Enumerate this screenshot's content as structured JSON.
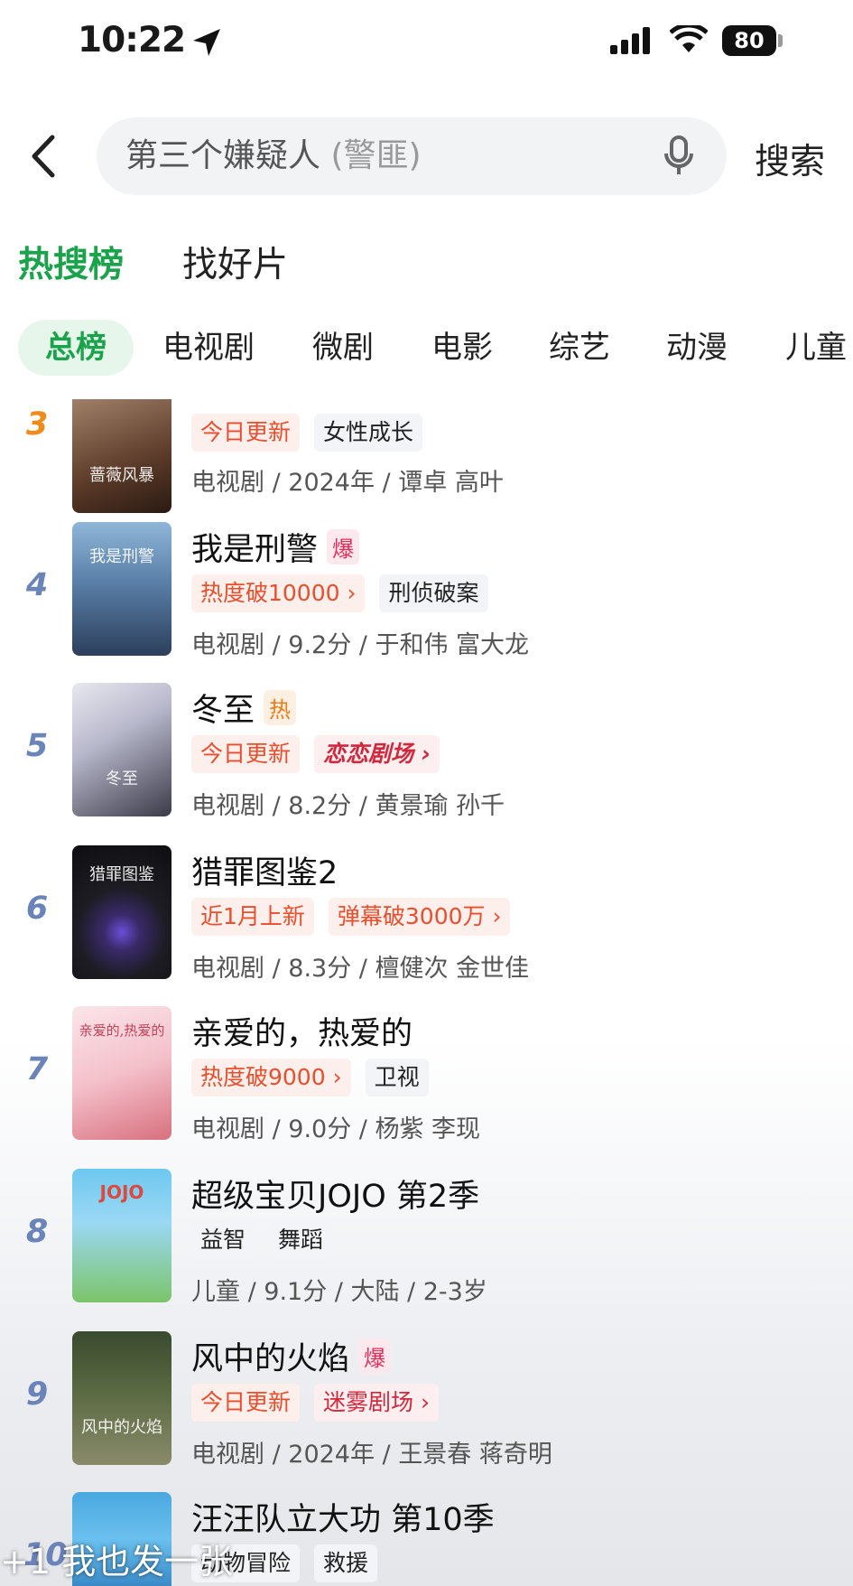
{
  "status": {
    "time": "10:22",
    "battery": "80"
  },
  "search": {
    "query": "第三个嫌疑人",
    "hint": "(警匪)",
    "button": "搜索"
  },
  "tabs": [
    "热搜榜",
    "找好片"
  ],
  "chips": [
    "总榜",
    "电视剧",
    "微剧",
    "电影",
    "综艺",
    "动漫",
    "儿童"
  ],
  "items": [
    {
      "rank": "3",
      "title": "",
      "badge": "",
      "poster_text": "蔷薇风暴",
      "tags": [
        "今日更新",
        "女性成长"
      ],
      "meta": "电视剧 / 2024年 / 谭卓 高叶"
    },
    {
      "rank": "4",
      "title": "我是刑警",
      "badge": "爆",
      "poster_text": "我是刑警",
      "tags": [
        "热度破10000 ›",
        "刑侦破案"
      ],
      "meta": "电视剧 / 9.2分 / 于和伟 富大龙"
    },
    {
      "rank": "5",
      "title": "冬至",
      "badge": "热",
      "poster_text": "冬至",
      "tags": [
        "今日更新",
        "恋恋剧场 ›"
      ],
      "meta": "电视剧 / 8.2分 / 黄景瑜 孙千"
    },
    {
      "rank": "6",
      "title": "猎罪图鉴2",
      "badge": "",
      "poster_text": "猎罪图鉴",
      "tags": [
        "近1月上新",
        "弹幕破3000万 ›"
      ],
      "meta": "电视剧 / 8.3分 / 檀健次 金世佳"
    },
    {
      "rank": "7",
      "title": "亲爱的，热爱的",
      "badge": "",
      "poster_text": "亲爱的,热爱的",
      "tags": [
        "热度破9000 ›",
        "卫视"
      ],
      "meta": "电视剧 / 9.0分 / 杨紫 李现"
    },
    {
      "rank": "8",
      "title": "超级宝贝JOJO 第2季",
      "badge": "",
      "poster_text": "JOJO",
      "tags": [
        "益智",
        "舞蹈"
      ],
      "meta": "儿童 / 9.1分 / 大陆 / 2-3岁"
    },
    {
      "rank": "9",
      "title": "风中的火焰",
      "badge": "爆",
      "poster_text": "风中的火焰",
      "tags": [
        "今日更新",
        "迷雾剧场 ›"
      ],
      "meta": "电视剧 / 2024年 / 王景春 蒋奇明"
    },
    {
      "rank": "10",
      "title": "汪汪队立大功 第10季",
      "badge": "",
      "poster_text": "",
      "tags": [
        "动物冒险",
        "救援"
      ],
      "meta": ""
    }
  ],
  "overlay": "+1 我也发一张"
}
